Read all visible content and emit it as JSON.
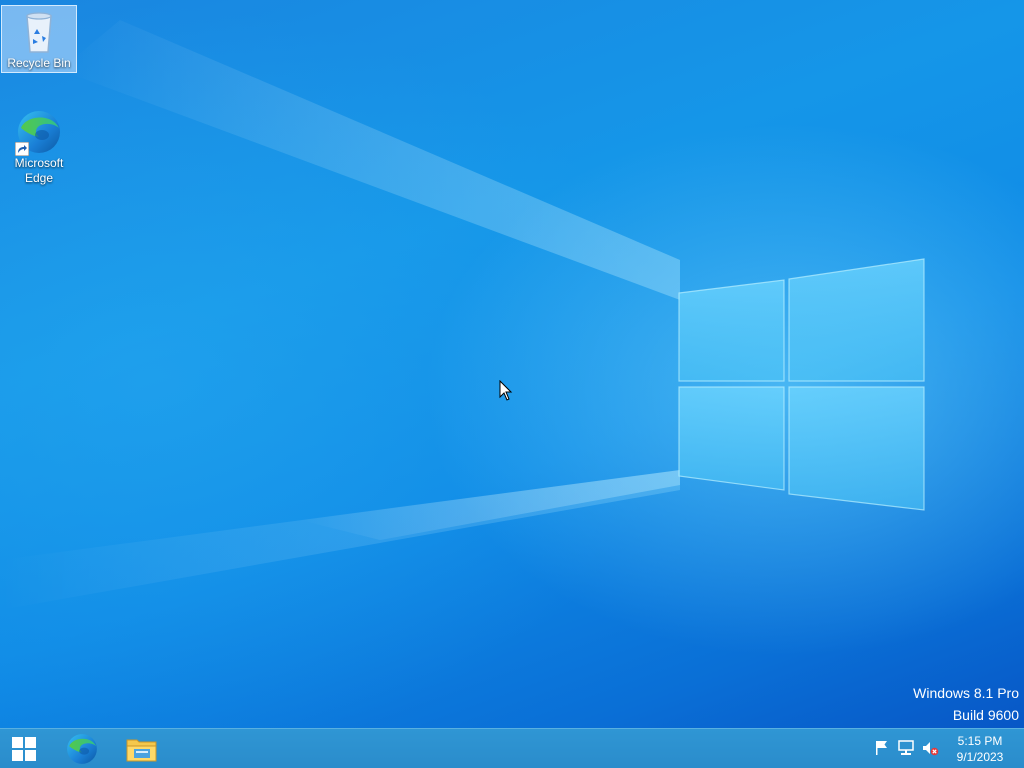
{
  "desktop": {
    "icons": [
      {
        "label": "Recycle Bin",
        "icon": "recycle-bin-icon",
        "selected": true
      },
      {
        "label": "Microsoft Edge",
        "icon": "edge-icon",
        "shortcut": true
      }
    ],
    "watermark": {
      "line1": "Windows 8.1 Pro",
      "line2": "Build 9600"
    }
  },
  "taskbar": {
    "start": {
      "icon": "windows-logo-icon"
    },
    "pinned": [
      {
        "icon": "edge-icon"
      },
      {
        "icon": "file-explorer-icon"
      }
    ],
    "tray": {
      "icons": [
        "action-center-flag-icon",
        "network-icon",
        "volume-muted-icon"
      ],
      "time": "5:15 PM",
      "date": "9/1/2023"
    }
  },
  "colors": {
    "desktop_blue": "#1596e8",
    "taskbar": "#2f96d4",
    "text": "#ffffff"
  }
}
